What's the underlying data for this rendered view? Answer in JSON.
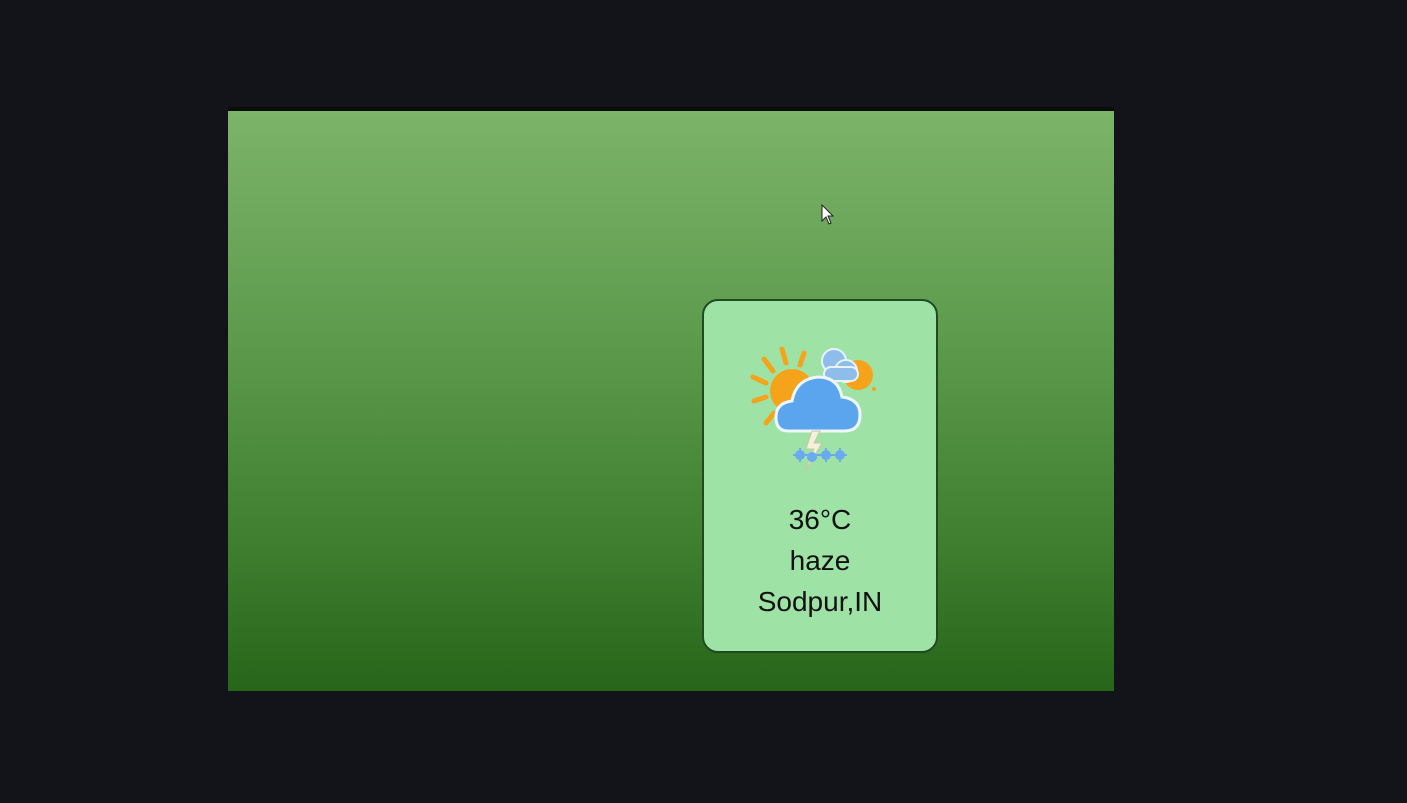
{
  "weather": {
    "temperature": "36°C",
    "condition": "haze",
    "location": "Sodpur,IN",
    "icon": "partly-cloudy-thunder-snow-icon"
  },
  "colors": {
    "background": "#131419",
    "card": "#9ee2a6",
    "sun": "#f5a31a",
    "cloud": "#5ba4ee"
  }
}
